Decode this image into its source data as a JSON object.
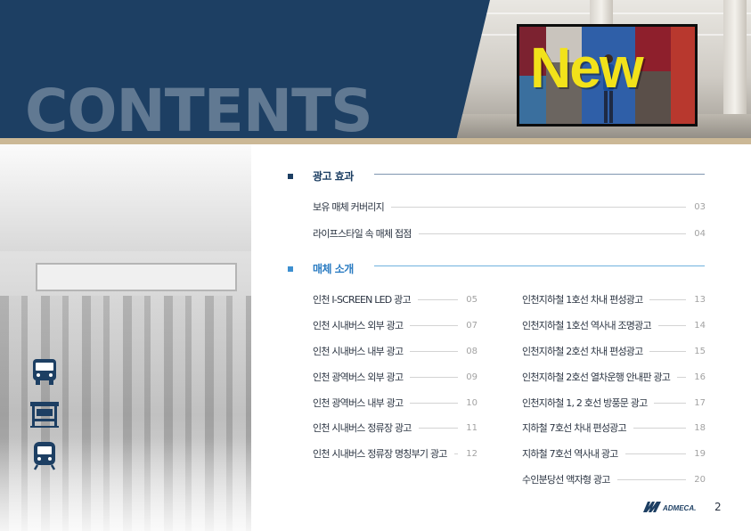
{
  "header": {
    "title": "CONTENTS",
    "photo_sign_text": "New"
  },
  "colors": {
    "navy": "#1d3f63",
    "gold": "#cbb896",
    "accent_blue": "#2b7cc2"
  },
  "sidebar_icons": [
    "bus-icon",
    "bus-stop-icon",
    "subway-icon"
  ],
  "sections": [
    {
      "title": "광고 효과",
      "items": [
        {
          "label": "보유 매체 커버리지",
          "page": "03"
        },
        {
          "label": "라이프스타일 속 매체 접점",
          "page": "04"
        }
      ]
    },
    {
      "title": "매체 소개",
      "left_items": [
        {
          "label": "인천 I-SCREEN LED 광고",
          "page": "05"
        },
        {
          "label": "인천 시내버스 외부 광고",
          "page": "07"
        },
        {
          "label": "인천 시내버스 내부 광고",
          "page": "08"
        },
        {
          "label": "인천 광역버스 외부 광고",
          "page": "09"
        },
        {
          "label": "인천 광역버스 내부 광고",
          "page": "10"
        },
        {
          "label": "인천 시내버스 정류장 광고",
          "page": "11"
        },
        {
          "label": "인천 시내버스 정류장 명칭부기 광고",
          "page": "12"
        }
      ],
      "right_items": [
        {
          "label": "인천지하철 1호선 차내 편성광고",
          "page": "13"
        },
        {
          "label": "인천지하철 1호선 역사내 조명광고",
          "page": "14"
        },
        {
          "label": "인천지하철 2호선 차내 편성광고",
          "page": "15"
        },
        {
          "label": "인천지하철 2호선 열차운행 안내판 광고",
          "page": "16"
        },
        {
          "label": "인천지하철 1, 2 호선 방풍문 광고",
          "page": "17"
        },
        {
          "label": "지하철 7호선 차내 편성광고",
          "page": "18"
        },
        {
          "label": "지하철 7호선 역사내 광고",
          "page": "19"
        },
        {
          "label": "수인분당선 액자형 광고",
          "page": "20"
        }
      ]
    }
  ],
  "footer": {
    "logo_text": "ADMECA.",
    "page_number": "2"
  }
}
